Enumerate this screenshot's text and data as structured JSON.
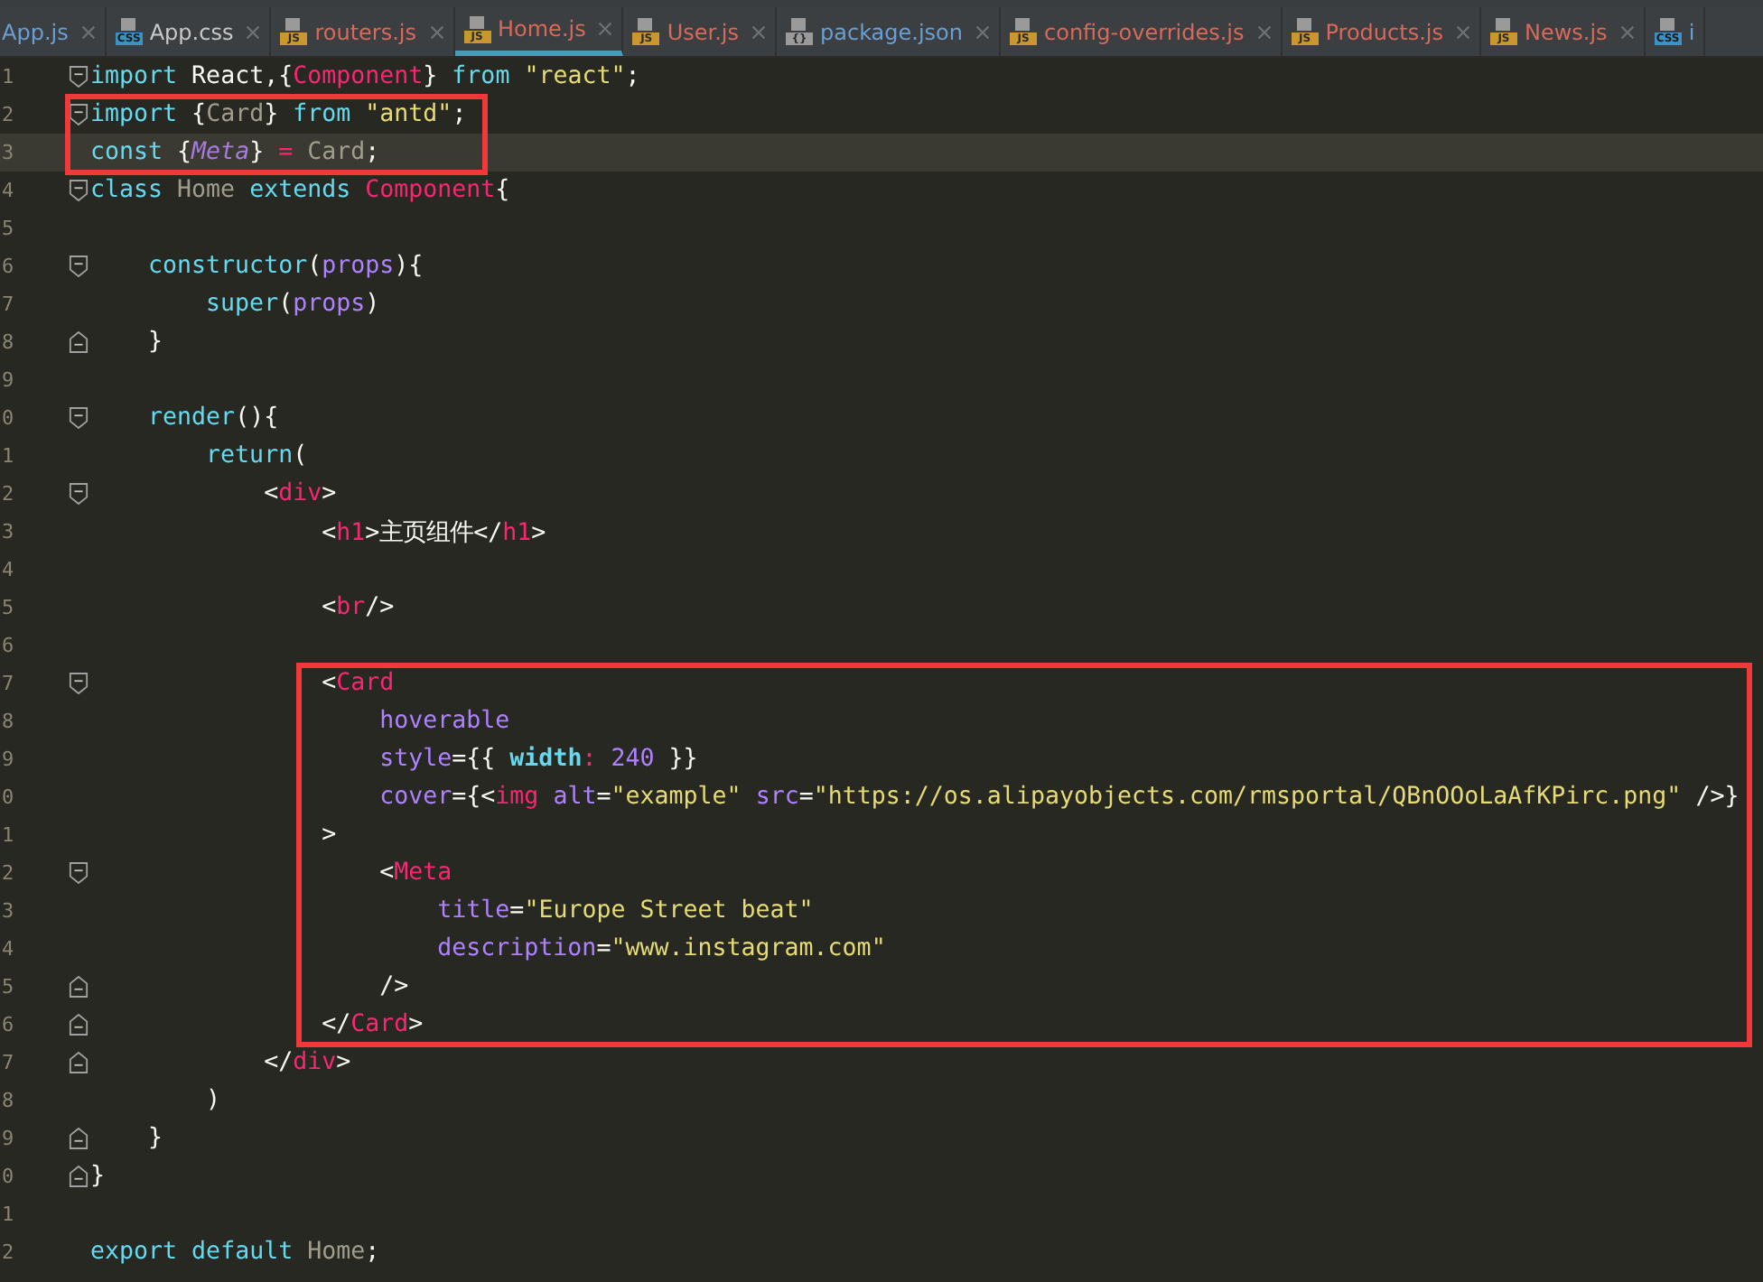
{
  "tabs": [
    {
      "label": "App.js",
      "kind": "plain",
      "color": "#6a9fd4",
      "selected": false
    },
    {
      "label": "App.css",
      "kind": "css",
      "badge": "CSS",
      "color": "#c8c8c8",
      "selected": false
    },
    {
      "label": "routers.js",
      "kind": "js",
      "badge": "JS",
      "color": "#d9695a",
      "selected": false
    },
    {
      "label": "Home.js",
      "kind": "js",
      "badge": "JS",
      "color": "#d9695a",
      "selected": true
    },
    {
      "label": "User.js",
      "kind": "js",
      "badge": "JS",
      "color": "#d9695a",
      "selected": false
    },
    {
      "label": "package.json",
      "kind": "json",
      "badge": "{}",
      "color": "#6a9fd4",
      "selected": false
    },
    {
      "label": "config-overrides.js",
      "kind": "js",
      "badge": "JS",
      "color": "#d9695a",
      "selected": false
    },
    {
      "label": "Products.js",
      "kind": "js",
      "badge": "JS",
      "color": "#d9695a",
      "selected": false
    },
    {
      "label": "News.js",
      "kind": "js",
      "badge": "JS",
      "color": "#d9695a",
      "selected": false
    },
    {
      "label": "i",
      "kind": "css",
      "badge": "CSS",
      "color": "#6a9fd4",
      "selected": false
    }
  ],
  "groups": [
    {
      "boxed": false,
      "lines": [
        {
          "n": "1",
          "kind": "fold-start",
          "current": false,
          "tokens": [
            {
              "text": "import",
              "kind": "kw"
            },
            {
              "text": " React,{",
              "kind": "plain"
            },
            {
              "text": "Component",
              "kind": "tag"
            },
            {
              "text": "} ",
              "kind": "plain"
            },
            {
              "text": "from",
              "kind": "kw"
            },
            {
              "text": " \"react\"",
              "kind": "str"
            },
            {
              "text": ";",
              "kind": "plain"
            }
          ]
        }
      ]
    },
    {
      "boxed": true,
      "lines": [
        {
          "n": "2",
          "kind": "fold-start",
          "current": false,
          "tokens": [
            {
              "text": "import",
              "kind": "kw"
            },
            {
              "text": " {",
              "kind": "plain"
            },
            {
              "text": "Card",
              "kind": "unused"
            },
            {
              "text": "} ",
              "kind": "plain"
            },
            {
              "text": "from",
              "kind": "kw"
            },
            {
              "text": " \"antd\"",
              "kind": "str"
            },
            {
              "text": ";",
              "kind": "plain"
            }
          ]
        },
        {
          "n": "3",
          "kind": "text",
          "current": true,
          "tokens": [
            {
              "text": "const",
              "kind": "kw"
            },
            {
              "text": " {",
              "kind": "plain"
            },
            {
              "text": "Meta",
              "kind": "unusedvar"
            },
            {
              "text": "} ",
              "kind": "plain"
            },
            {
              "text": "=",
              "kind": "tag"
            },
            {
              "text": " Card",
              "kind": "unused"
            },
            {
              "text": ";",
              "kind": "plain"
            }
          ]
        }
      ]
    },
    {
      "boxed": false,
      "lines": [
        {
          "n": "4",
          "kind": "fold-start",
          "current": false,
          "tokens": [
            {
              "text": "class",
              "kind": "kw"
            },
            {
              "text": " Home",
              "kind": "unused"
            },
            {
              "text": " extends",
              "kind": "kw"
            },
            {
              "text": " Component",
              "kind": "tag"
            },
            {
              "text": "{",
              "kind": "plain"
            }
          ]
        },
        {
          "n": "5",
          "kind": "text",
          "current": false
        },
        {
          "n": "6",
          "kind": "fold-start",
          "current": false,
          "tokens": [
            {
              "text": "    constructor",
              "kind": "kw"
            },
            {
              "text": "(",
              "kind": "plain"
            },
            {
              "text": "props",
              "kind": "attr"
            },
            {
              "text": "){",
              "kind": "plain"
            }
          ]
        },
        {
          "n": "7",
          "kind": "text",
          "current": false,
          "tokens": [
            {
              "text": "        super",
              "kind": "kw"
            },
            {
              "text": "(",
              "kind": "plain"
            },
            {
              "text": "props",
              "kind": "attr"
            },
            {
              "text": ")",
              "kind": "plain"
            }
          ]
        },
        {
          "n": "8",
          "kind": "fold-end",
          "current": false,
          "tokens": [
            {
              "text": "    }",
              "kind": "plain"
            }
          ]
        },
        {
          "n": "9",
          "kind": "text",
          "current": false
        },
        {
          "n": "0",
          "kind": "fold-start",
          "current": false,
          "tokens": [
            {
              "text": "    render",
              "kind": "kw"
            },
            {
              "text": "(){",
              "kind": "plain"
            }
          ]
        },
        {
          "n": "1",
          "kind": "text",
          "current": false,
          "tokens": [
            {
              "text": "        return",
              "kind": "kw"
            },
            {
              "text": "(",
              "kind": "plain"
            }
          ]
        },
        {
          "n": "2",
          "kind": "fold-start",
          "current": false,
          "tokens": [
            {
              "text": "            <",
              "kind": "plain"
            },
            {
              "text": "div",
              "kind": "tag"
            },
            {
              "text": ">",
              "kind": "plain"
            }
          ]
        },
        {
          "n": "3",
          "kind": "text",
          "current": false,
          "tokens": [
            {
              "text": "                <",
              "kind": "plain"
            },
            {
              "text": "h1",
              "kind": "tag"
            },
            {
              "text": ">主页组件</",
              "kind": "plain"
            },
            {
              "text": "h1",
              "kind": "tag"
            },
            {
              "text": ">",
              "kind": "plain"
            }
          ]
        },
        {
          "n": "4",
          "kind": "text",
          "current": false
        },
        {
          "n": "5",
          "kind": "text",
          "current": false,
          "tokens": [
            {
              "text": "                <",
              "kind": "plain"
            },
            {
              "text": "br",
              "kind": "tag"
            },
            {
              "text": "/>",
              "kind": "plain"
            }
          ]
        },
        {
          "n": "6",
          "kind": "text",
          "current": false
        }
      ]
    },
    {
      "boxed": true,
      "lines": [
        {
          "n": "7",
          "kind": "fold-start",
          "current": false,
          "tokens": [
            {
              "text": "                <",
              "kind": "plain"
            },
            {
              "text": "Card",
              "kind": "tag"
            }
          ]
        },
        {
          "n": "8",
          "kind": "text",
          "current": false,
          "tokens": [
            {
              "text": "                    hoverable",
              "kind": "attr"
            }
          ]
        },
        {
          "n": "9",
          "kind": "text",
          "current": false,
          "tokens": [
            {
              "text": "                    style",
              "kind": "attr"
            },
            {
              "text": "={{ ",
              "kind": "plain"
            },
            {
              "text": "width",
              "kind": "prop"
            },
            {
              "text": ": ",
              "kind": "tag"
            },
            {
              "text": "240",
              "kind": "attr"
            },
            {
              "text": " }}",
              "kind": "plain"
            }
          ]
        },
        {
          "n": "0",
          "kind": "text",
          "current": false,
          "tokens": [
            {
              "text": "                    cover",
              "kind": "attr"
            },
            {
              "text": "={<",
              "kind": "plain"
            },
            {
              "text": "img",
              "kind": "tag"
            },
            {
              "text": " alt",
              "kind": "attr"
            },
            {
              "text": "=",
              "kind": "plain"
            },
            {
              "text": "\"example\"",
              "kind": "str"
            },
            {
              "text": " src",
              "kind": "attr"
            },
            {
              "text": "=",
              "kind": "plain"
            },
            {
              "text": "\"https://os.alipayobjects.com/rmsportal/QBnOOoLaAfKPirc.png\"",
              "kind": "str"
            },
            {
              "text": " />}",
              "kind": "plain"
            }
          ]
        },
        {
          "n": "1",
          "kind": "text",
          "current": false,
          "tokens": [
            {
              "text": "                >",
              "kind": "plain"
            }
          ]
        },
        {
          "n": "2",
          "kind": "fold-start",
          "current": false,
          "tokens": [
            {
              "text": "                    <",
              "kind": "plain"
            },
            {
              "text": "Meta",
              "kind": "tag"
            }
          ]
        },
        {
          "n": "3",
          "kind": "text",
          "current": false,
          "tokens": [
            {
              "text": "                        title",
              "kind": "attr"
            },
            {
              "text": "=",
              "kind": "plain"
            },
            {
              "text": "\"Europe Street beat\"",
              "kind": "str"
            }
          ]
        },
        {
          "n": "4",
          "kind": "text",
          "current": false,
          "tokens": [
            {
              "text": "                        description",
              "kind": "attr"
            },
            {
              "text": "=",
              "kind": "plain"
            },
            {
              "text": "\"www.instagram.com\"",
              "kind": "str"
            }
          ]
        },
        {
          "n": "5",
          "kind": "fold-end",
          "current": false,
          "tokens": [
            {
              "text": "                    />",
              "kind": "plain"
            }
          ]
        },
        {
          "n": "6",
          "kind": "fold-end",
          "current": false,
          "tokens": [
            {
              "text": "                </",
              "kind": "plain"
            },
            {
              "text": "Card",
              "kind": "tag"
            },
            {
              "text": ">",
              "kind": "plain"
            }
          ]
        }
      ]
    },
    {
      "boxed": false,
      "lines": [
        {
          "n": "7",
          "kind": "fold-end",
          "current": false,
          "tokens": [
            {
              "text": "            </",
              "kind": "plain"
            },
            {
              "text": "div",
              "kind": "tag"
            },
            {
              "text": ">",
              "kind": "plain"
            }
          ]
        },
        {
          "n": "8",
          "kind": "text",
          "current": false,
          "tokens": [
            {
              "text": "        )",
              "kind": "plain"
            }
          ]
        },
        {
          "n": "9",
          "kind": "fold-end",
          "current": false,
          "tokens": [
            {
              "text": "    }",
              "kind": "plain"
            }
          ]
        },
        {
          "n": "0",
          "kind": "fold-end",
          "current": false,
          "tokens": [
            {
              "text": "}",
              "kind": "plain"
            }
          ]
        },
        {
          "n": "1",
          "kind": "text",
          "current": false
        },
        {
          "n": "2",
          "kind": "text",
          "current": false,
          "tokens": [
            {
              "text": "export",
              "kind": "kw"
            },
            {
              "text": " default",
              "kind": "kw"
            },
            {
              "text": " Home",
              "kind": "unused"
            },
            {
              "text": ";",
              "kind": "plain"
            }
          ]
        }
      ]
    }
  ]
}
